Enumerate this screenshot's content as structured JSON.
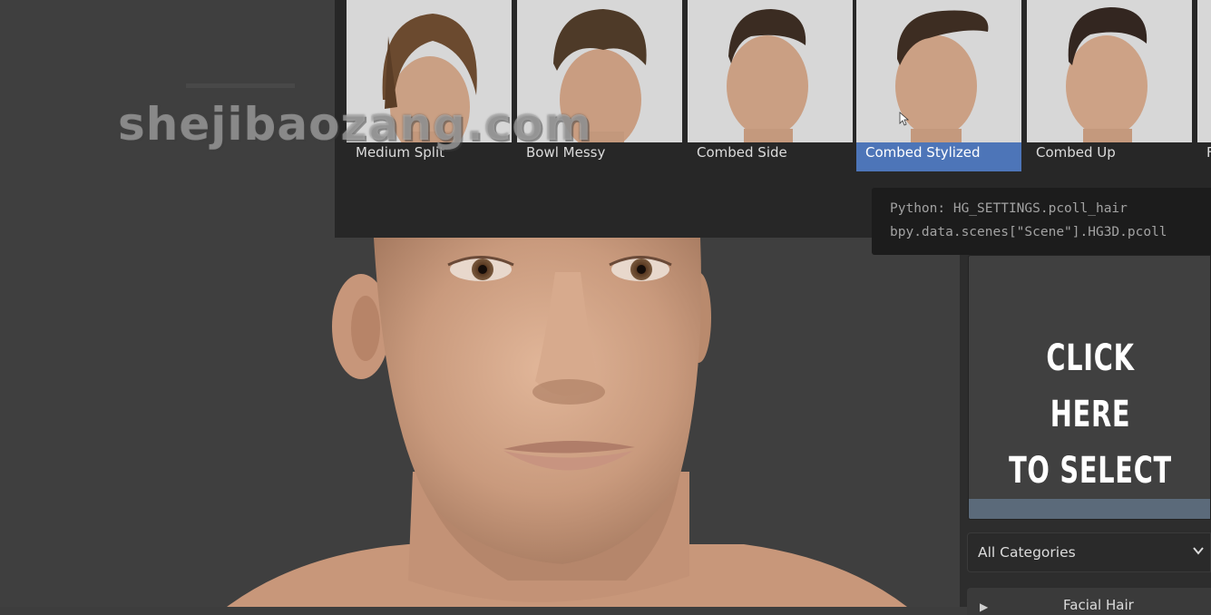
{
  "hair_styles": [
    {
      "label": "Medium Split",
      "selected": false
    },
    {
      "label": "Bowl Messy",
      "selected": false
    },
    {
      "label": "Combed Side",
      "selected": false
    },
    {
      "label": "Combed Stylized",
      "selected": true
    },
    {
      "label": "Combed Up",
      "selected": false
    },
    {
      "label": "F",
      "selected": false
    }
  ],
  "tooltip": {
    "line1": "Python: HG_SETTINGS.pcoll_hair",
    "line2": "bpy.data.scenes[\"Scene\"].HG3D.pcoll"
  },
  "preview": {
    "line1": "CLICK HERE",
    "line2": "TO SELECT"
  },
  "category_select": {
    "value": "All Categories"
  },
  "facial_hair_panel": {
    "label": "Facial Hair"
  },
  "watermark": "shejibaozang.com",
  "colors": {
    "selected_accent": "#4d75b8",
    "viewport_bg": "#3f3f3f",
    "panel_bg": "#2d2d2d",
    "popup_bg": "#272727",
    "skin": "#d1a486"
  },
  "icons": {
    "dropdown": "chevron-down-icon",
    "panel_toggle": "triangle-right-icon",
    "pointer": "mouse-cursor-icon"
  }
}
